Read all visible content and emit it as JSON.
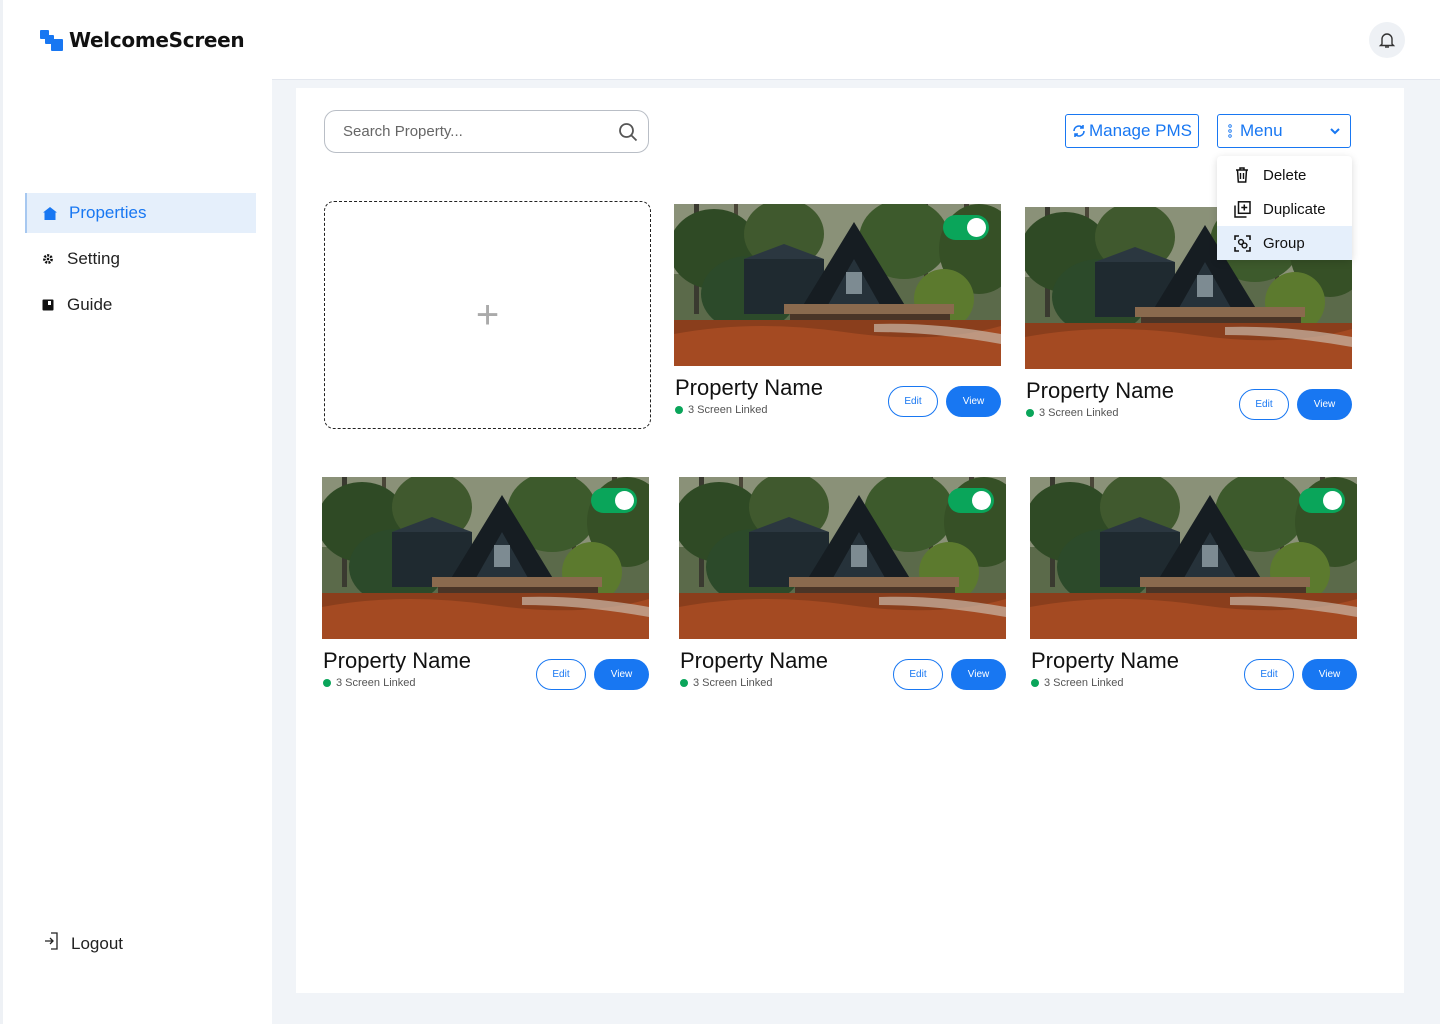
{
  "app": {
    "name": "WelcomeScreen"
  },
  "sidebar": {
    "items": [
      {
        "label": "Properties",
        "icon": "home-icon",
        "active": true
      },
      {
        "label": "Setting",
        "icon": "gear-icon",
        "active": false
      },
      {
        "label": "Guide",
        "icon": "book-icon",
        "active": false
      }
    ],
    "logout_label": "Logout"
  },
  "header": {
    "notification_icon": "bell-icon"
  },
  "toolbar": {
    "search_placeholder": "Search Property...",
    "manage_pms_label": "Manage PMS",
    "menu_label": "Menu"
  },
  "menu": {
    "items": [
      {
        "label": "Delete",
        "icon": "trash-icon"
      },
      {
        "label": "Duplicate",
        "icon": "duplicate-icon"
      },
      {
        "label": "Group",
        "icon": "group-icon",
        "highlighted": true
      }
    ]
  },
  "add_card": {
    "symbol": "+"
  },
  "properties": [
    {
      "name": "Property Name",
      "status": "3 Screen Linked",
      "enabled": true,
      "edit_label": "Edit",
      "view_label": "View"
    },
    {
      "name": "Property Name",
      "status": "3 Screen Linked",
      "enabled": true,
      "edit_label": "Edit",
      "view_label": "View"
    },
    {
      "name": "Property Name",
      "status": "3 Screen Linked",
      "enabled": true,
      "edit_label": "Edit",
      "view_label": "View"
    },
    {
      "name": "Property Name",
      "status": "3 Screen Linked",
      "enabled": true,
      "edit_label": "Edit",
      "view_label": "View"
    },
    {
      "name": "Property Name",
      "status": "3 Screen Linked",
      "enabled": true,
      "edit_label": "Edit",
      "view_label": "View"
    }
  ],
  "colors": {
    "accent": "#1877f2",
    "success": "#0aa55a",
    "active_bg": "#e5effb"
  }
}
